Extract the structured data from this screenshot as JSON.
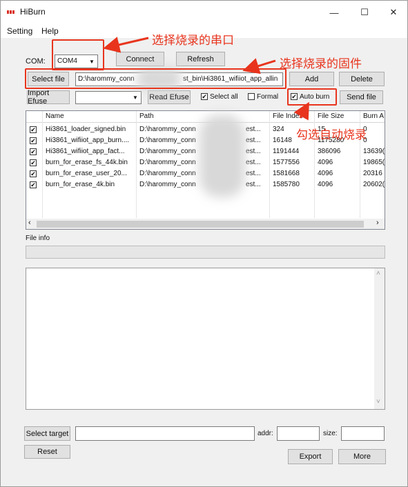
{
  "window": {
    "title": "HiBurn",
    "minimize": "—",
    "maximize": "☐",
    "close": "✕"
  },
  "menu": [
    "Setting",
    "Help"
  ],
  "toolbar": {
    "com_label": "COM:",
    "com_value": "COM4",
    "connect": "Connect",
    "refresh": "Refresh",
    "select_file": "Select file",
    "file_path": "D:\\harommy_conn",
    "file_path_tail": "st_bin\\Hi3861_wifiiot_app_allin",
    "add": "Add",
    "delete": "Delete",
    "import_efuse": "Import Efuse",
    "read_efuse": "Read Efuse",
    "select_all": "Select all",
    "formal": "Formal",
    "auto_burn": "Auto burn",
    "send_file": "Send file"
  },
  "table": {
    "columns": [
      "Name",
      "Path",
      "File Index",
      "File Size",
      "Burn A"
    ],
    "rows": [
      {
        "name": "Hi3861_loader_signed.bin",
        "path": "D:\\harommy_conn",
        "path_tail": "est...",
        "index": "324",
        "size": "15",
        "burn": "0"
      },
      {
        "name": "Hi3861_wifiiot_app_burn....",
        "path": "D:\\harommy_conn",
        "path_tail": "est...",
        "index": "16148",
        "size": "1175280",
        "burn": "0"
      },
      {
        "name": "Hi3861_wifiiot_app_fact...",
        "path": "D:\\harommy_conn",
        "path_tail": "est...",
        "index": "1191444",
        "size": "386096",
        "burn": "13639("
      },
      {
        "name": "burn_for_erase_fs_44k.bin",
        "path": "D:\\harommy_conn",
        "path_tail": "est...",
        "index": "1577556",
        "size": "4096",
        "burn": "19865("
      },
      {
        "name": "burn_for_erase_user_20...",
        "path": "D:\\harommy_conn",
        "path_tail": "est...",
        "index": "1581668",
        "size": "4096",
        "burn": "20316"
      },
      {
        "name": "burn_for_erase_4k.bin",
        "path": "D:\\harommy_conn",
        "path_tail": "est...",
        "index": "1585780",
        "size": "4096",
        "burn": "20602("
      }
    ]
  },
  "file_info_label": "File info",
  "bottom": {
    "select_target": "Select target",
    "addr": "addr:",
    "size": "size:",
    "reset": "Reset",
    "export": "Export",
    "more": "More"
  },
  "annotations": {
    "serial_port": "选择烧录的串口",
    "firmware": "选择烧录的固件",
    "auto_burn": "勾选自动烧录"
  },
  "colors": {
    "annotation": "#e8341d",
    "window_bg": "#f0f0f0"
  },
  "icons": {
    "check": "✔",
    "dropdown": "▼",
    "scroll_left": "‹",
    "scroll_right": "›",
    "scroll_up": "˄",
    "scroll_down": "˅"
  }
}
